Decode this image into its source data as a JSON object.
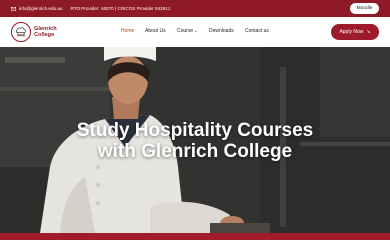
{
  "topbar": {
    "email": "info@glenrich.edu.au",
    "rto_text": "RTO Provider: 46070 | CRICOS Provider 04281J",
    "moodle_label": "Moodle",
    "mail_icon": "mail-icon"
  },
  "brand": {
    "line1": "Glenrich",
    "line2": "College",
    "logo_icon": "chef-hat-logo-icon",
    "color": "#8e1a27"
  },
  "nav": {
    "items": [
      {
        "label": "Home",
        "active": true
      },
      {
        "label": "About Us"
      },
      {
        "label": "Course",
        "has_dropdown": true
      },
      {
        "label": "Downloads"
      },
      {
        "label": "Contact us"
      }
    ],
    "course_chevron": "⌄",
    "apply_label": "Apply Now",
    "apply_icon": "arrow-right-icon"
  },
  "hero": {
    "title_line1": "Study Hospitality Courses",
    "title_line2": "with Glenrich College"
  },
  "colors": {
    "accent": "#9e1b2a",
    "active_nav": "#c0392b"
  }
}
